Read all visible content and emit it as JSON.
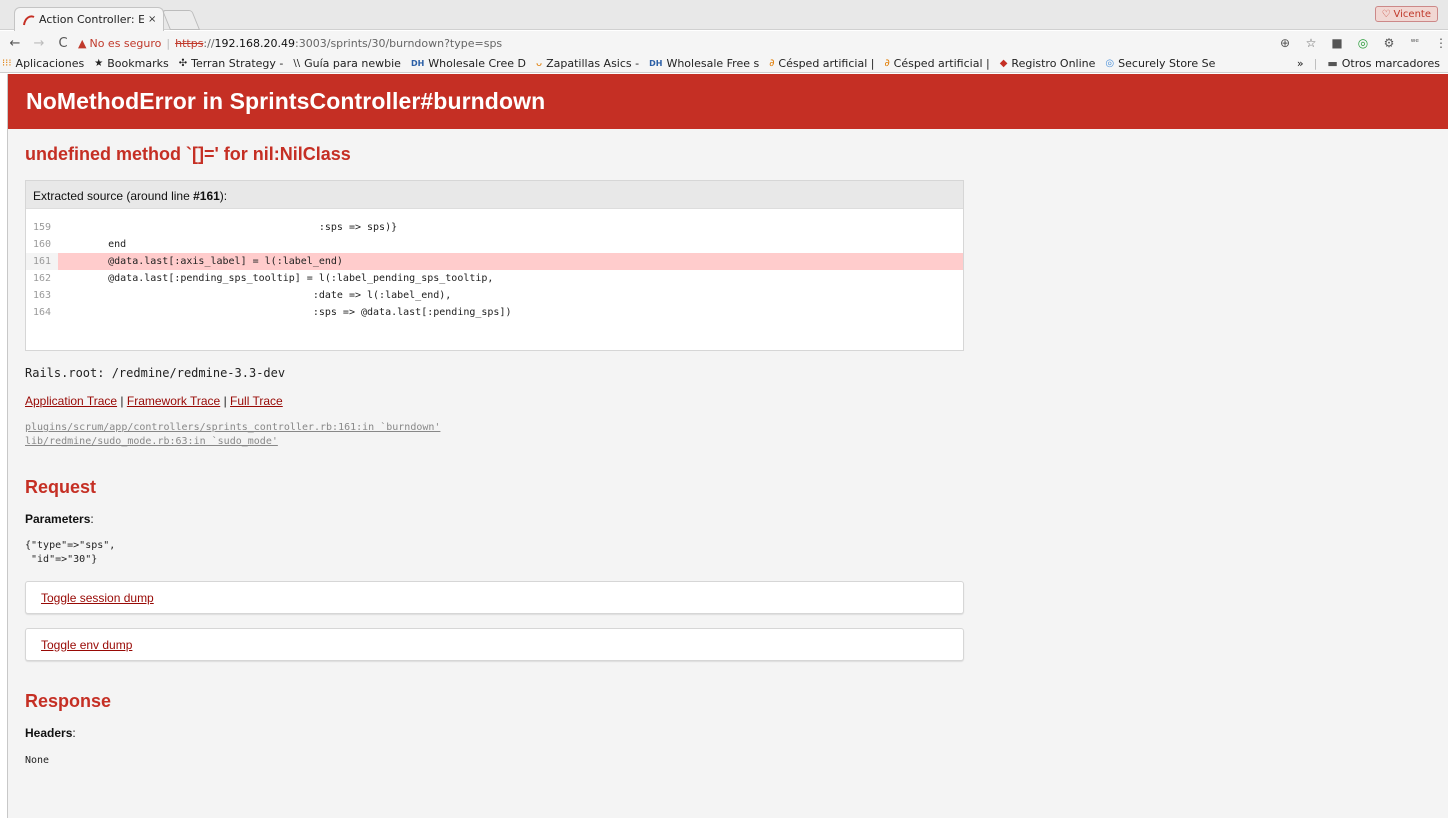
{
  "browser": {
    "tab_title": "Action Controller: E",
    "tab_close": "×",
    "profile_name": "Vicente",
    "security_label": "No es seguro",
    "url_protocol": "https",
    "url_sep": "://",
    "url_host": "192.168.20.49",
    "url_rest": ":3003/sprints/30/burndown?type=sps"
  },
  "bookmarks": {
    "items": [
      {
        "label": "Aplicaciones",
        "icon": "apps-grid-icon"
      },
      {
        "label": "Bookmarks",
        "icon": "star-icon"
      },
      {
        "label": "Terran Strategy -",
        "icon": "terran-icon"
      },
      {
        "label": "Guía para newbie",
        "icon": "guide-icon"
      },
      {
        "label": "Wholesale Cree D",
        "icon": "dh-icon"
      },
      {
        "label": "Zapatillas Asics -",
        "icon": "asics-icon"
      },
      {
        "label": "Wholesale Free s",
        "icon": "dh-icon"
      },
      {
        "label": "Césped artificial |",
        "icon": "cesped-icon"
      },
      {
        "label": "Césped artificial |",
        "icon": "cesped-icon"
      },
      {
        "label": "Registro Online",
        "icon": "registro-icon"
      },
      {
        "label": "Securely Store Se",
        "icon": "secure-icon"
      }
    ],
    "overflow": "»",
    "other": "Otros marcadores"
  },
  "error": {
    "title": "NoMethodError in SprintsController#burndown",
    "message": "undefined method `[]=' for nil:NilClass"
  },
  "source": {
    "heading_prefix": "Extracted source (around line ",
    "heading_line": "#161",
    "heading_suffix": "):",
    "lines": [
      {
        "num": "159",
        "code": "                                         :sps => sps)}",
        "highlight": false
      },
      {
        "num": "160",
        "code": "      end",
        "highlight": false
      },
      {
        "num": "161",
        "code": "      @data.last[:axis_label] = l(:label_end)",
        "highlight": true
      },
      {
        "num": "162",
        "code": "      @data.last[:pending_sps_tooltip] = l(:label_pending_sps_tooltip,",
        "highlight": false
      },
      {
        "num": "163",
        "code": "                                        :date => l(:label_end),",
        "highlight": false
      },
      {
        "num": "164",
        "code": "                                        :sps => @data.last[:pending_sps])",
        "highlight": false
      }
    ]
  },
  "rails_root": "Rails.root: /redmine/redmine-3.3-dev",
  "trace": {
    "application": "Application Trace",
    "framework": "Framework Trace",
    "full": "Full Trace",
    "divider": "|",
    "lines": [
      "plugins/scrum/app/controllers/sprints_controller.rb:161:in `burndown'",
      "lib/redmine/sudo_mode.rb:63:in `sudo_mode'"
    ]
  },
  "request": {
    "heading": "Request",
    "params_label": "Parameters",
    "params_value": "{\"type\"=>\"sps\",\n \"id\"=>\"30\"}",
    "session_toggle": "Toggle session dump",
    "env_toggle": "Toggle env dump"
  },
  "response": {
    "heading": "Response",
    "headers_label": "Headers",
    "headers_value": "None"
  }
}
